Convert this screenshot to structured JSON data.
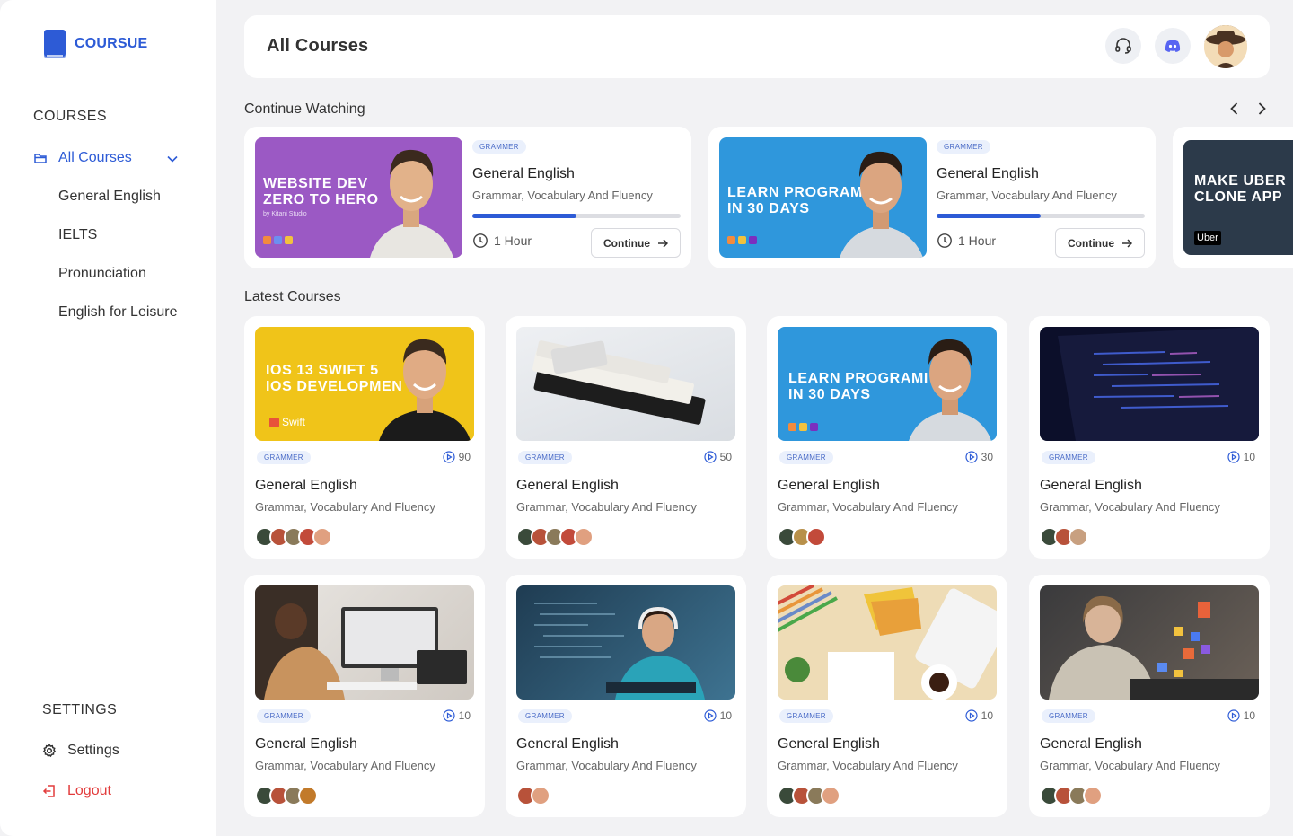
{
  "brand": {
    "name": "COURSUE"
  },
  "sidebar": {
    "courses_label": "COURSES",
    "active_item": "All Courses",
    "sub_items": [
      "General English",
      "IELTS",
      "Pronunciation",
      "English for Leisure"
    ],
    "settings_label": "SETTINGS",
    "settings_item": "Settings",
    "logout_item": "Logout"
  },
  "header": {
    "title": "All Courses"
  },
  "continue_watching": {
    "title": "Continue Watching",
    "cards": [
      {
        "thumb_title": "WEBSITE DEV\nZERO TO HERO",
        "thumb_sub": "by Kitani Studio",
        "badge": "GRAMMER",
        "title": "General English",
        "subtitle": "Grammar, Vocabulary And Fluency",
        "progress": 0.5,
        "duration": "1 Hour",
        "button": "Continue"
      },
      {
        "thumb_title": "LEARN PROGRAMI\nIN 30 DAYS",
        "badge": "GRAMMER",
        "title": "General English",
        "subtitle": "Grammar, Vocabulary And Fluency",
        "progress": 0.5,
        "duration": "1 Hour",
        "button": "Continue"
      },
      {
        "thumb_title": "MAKE UBER\nCLONE APP",
        "thumb_sub": "Uber"
      }
    ]
  },
  "latest": {
    "title": "Latest Courses",
    "cards": [
      {
        "thumb_title": "IOS 13 SWIFT 5\nIOS DEVELOPMEN",
        "thumb_sub": "Swift",
        "badge": "GRAMMER",
        "count": "90",
        "title": "General English",
        "subtitle": "Grammar, Vocabulary And Fluency"
      },
      {
        "badge": "GRAMMER",
        "count": "50",
        "title": "General English",
        "subtitle": "Grammar, Vocabulary And Fluency"
      },
      {
        "thumb_title": "LEARN PROGRAMI\nIN 30 DAYS",
        "badge": "GRAMMER",
        "count": "30",
        "title": "General English",
        "subtitle": "Grammar, Vocabulary And Fluency"
      },
      {
        "badge": "GRAMMER",
        "count": "10",
        "title": "General English",
        "subtitle": "Grammar, Vocabulary And Fluency"
      },
      {
        "badge": "GRAMMER",
        "count": "10",
        "title": "General English",
        "subtitle": "Grammar, Vocabulary And Fluency"
      },
      {
        "badge": "GRAMMER",
        "count": "10",
        "title": "General English",
        "subtitle": "Grammar, Vocabulary And Fluency"
      },
      {
        "badge": "GRAMMER",
        "count": "10",
        "title": "General English",
        "subtitle": "Grammar, Vocabulary And Fluency"
      },
      {
        "badge": "GRAMMER",
        "count": "10",
        "title": "General English",
        "subtitle": "Grammar, Vocabulary And Fluency"
      }
    ]
  },
  "colors": {
    "accent": "#2d5bd6",
    "logout": "#e23b3b",
    "purple": "#9b59c4",
    "blue": "#2f97dc",
    "yellow": "#f0c419",
    "dark": "#2c3a4a"
  }
}
